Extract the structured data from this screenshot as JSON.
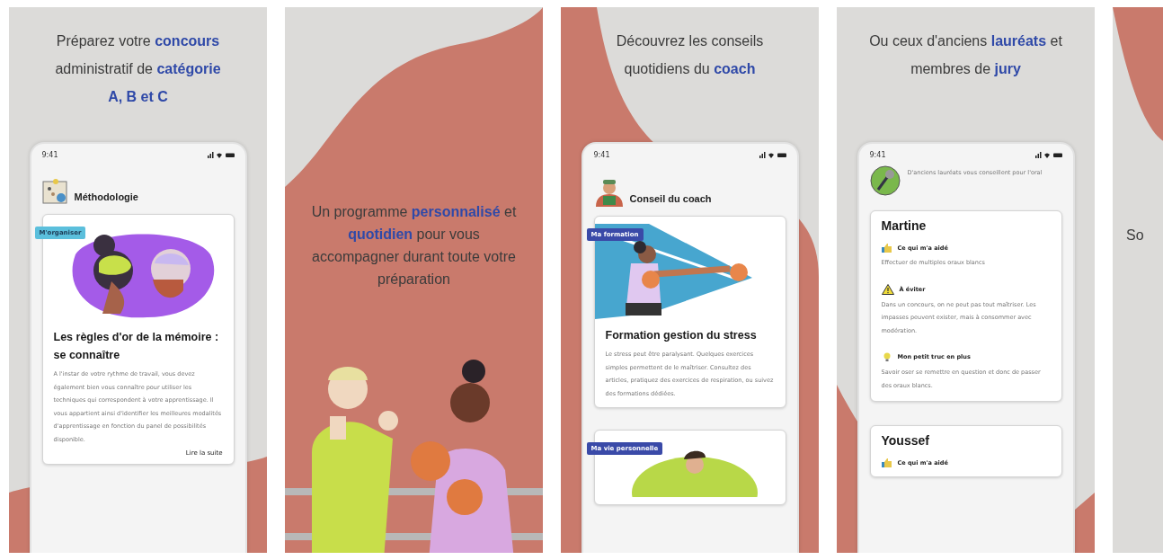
{
  "panels": [
    {
      "kind": "phone",
      "caption": "Préparez votre **concours** administratif de **catégorie A, B et C**",
      "screen": {
        "kind": "articles",
        "time": "9:41",
        "header": "Méthodologie",
        "cards": [
          {
            "tag": "M'organiser",
            "color": "#5bbfdc",
            "title": "Les règles d'or de la mémoire : se connaître",
            "body": "A l'instar de votre rythme de travail, vous devez également bien vous connaître pour utiliser les techniques qui correspondent à votre apprentissage. Il vous appartient ainsi d'identifier les meilleures modalités d'apprentissage en fonction du panel de possibilités disponible.",
            "link": "Lire la suite"
          }
        ]
      }
    },
    {
      "kind": "illustration",
      "caption": "Un programme **personnalisé** et **quotidien** pour vous accompagner durant toute votre préparation"
    },
    {
      "kind": "phone",
      "caption": "Découvrez les conseils quotidiens du **coach**",
      "screen": {
        "kind": "articles",
        "time": "9:41",
        "header": "Conseil du coach",
        "cards": [
          {
            "tag": "Ma formation",
            "color": "#3a4aa8",
            "title": "Formation gestion du stress",
            "body": "Le stress peut être paralysant. Quelques exercices simples permettent de le maîtriser. Consultez des articles, pratiquez des exercices de respiration, ou suivez des formations dédiées."
          },
          {
            "tag": "Ma vie personnelle",
            "color": "#3a4aa8"
          }
        ]
      }
    },
    {
      "kind": "phone",
      "caption": "Ou ceux d'anciens **lauréats** et membres de **jury**",
      "screen": {
        "kind": "testimonials",
        "time": "9:41",
        "intro": "D'anciens lauréats vous conseillent pour l'oral",
        "people": [
          {
            "name": "Martine",
            "tips": [
              {
                "kind": "thumb",
                "heading": "Ce qui m'a aidé",
                "text": "Effectuer de multiples oraux blancs"
              },
              {
                "kind": "warning",
                "heading": "À éviter",
                "text": "Dans un concours, on ne peut pas tout maîtriser. Les impasses peuvent exister, mais à consommer avec modération."
              },
              {
                "kind": "bulb",
                "heading": "Mon petit truc en plus",
                "text": "Savoir oser se remettre en question et donc de passer des oraux blancs."
              }
            ]
          },
          {
            "name": "Youssef",
            "tips": [
              {
                "kind": "thumb",
                "heading": "Ce qui m'a aidé"
              }
            ]
          }
        ]
      }
    },
    {
      "kind": "caption",
      "caption": "So"
    }
  ]
}
